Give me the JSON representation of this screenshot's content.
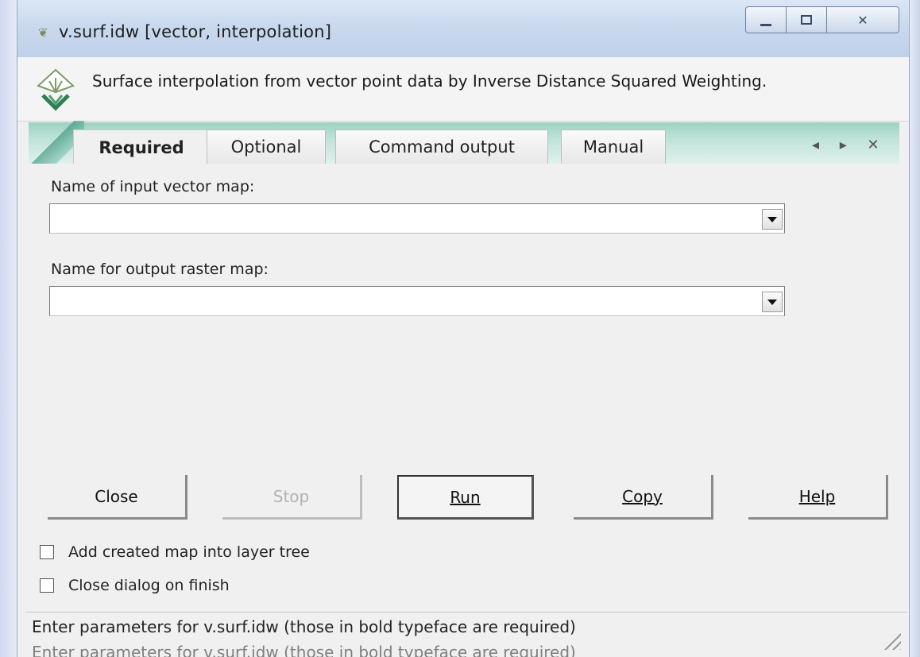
{
  "window": {
    "title": "v.surf.idw [vector, interpolation]",
    "controls": {
      "minimize_icon": "minimize-icon",
      "maximize_icon": "maximize-icon",
      "close_glyph": "✕"
    }
  },
  "header": {
    "description": "Surface interpolation from vector point data by Inverse Distance Squared Weighting."
  },
  "tabs": [
    {
      "label": "Required",
      "active": true
    },
    {
      "label": "Optional",
      "active": false
    },
    {
      "label": "Command output",
      "active": false
    },
    {
      "label": "Manual",
      "active": false
    }
  ],
  "notebook_controls": "◂ ▸ ✕",
  "fields": {
    "input": {
      "label": "Name of input vector map:",
      "value": ""
    },
    "output": {
      "label": "Name for output raster map:",
      "value": ""
    }
  },
  "buttons": {
    "close": "Close",
    "stop": "Stop",
    "run": "Run",
    "copy": "Copy",
    "help": "Help"
  },
  "checkboxes": {
    "add_map": {
      "label": "Add created map into layer tree",
      "checked": false
    },
    "close_dialog": {
      "label": "Close dialog on finish",
      "checked": false
    }
  },
  "status": {
    "text": "Enter parameters for v.surf.idw (those in bold typeface are required)"
  },
  "colors": {
    "notebook_accent": "#9bd2c2",
    "window_bg": "#f0f0f0"
  }
}
